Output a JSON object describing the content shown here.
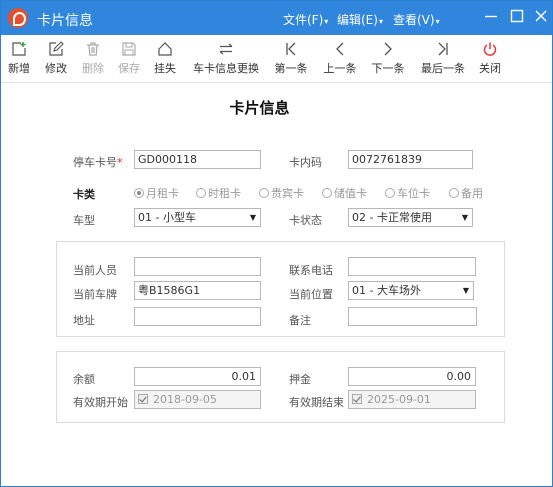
{
  "window": {
    "title": "卡片信息",
    "menus": [
      {
        "label": "文件(F)"
      },
      {
        "label": "编辑(E)"
      },
      {
        "label": "查看(V)"
      }
    ]
  },
  "toolbar": {
    "buttons": [
      {
        "label": "新增",
        "icon": "add-icon",
        "enabled": true
      },
      {
        "label": "修改",
        "icon": "edit-icon",
        "enabled": true
      },
      {
        "label": "删除",
        "icon": "trash-icon",
        "enabled": false
      },
      {
        "label": "保存",
        "icon": "save-icon",
        "enabled": false
      },
      {
        "label": "挂失",
        "icon": "home-icon",
        "enabled": true
      },
      {
        "label": "车卡信息更换",
        "icon": "swap-icon",
        "enabled": true
      },
      {
        "label": "第一条",
        "icon": "first-icon",
        "enabled": true
      },
      {
        "label": "上一条",
        "icon": "prev-icon",
        "enabled": true
      },
      {
        "label": "下一条",
        "icon": "next-icon",
        "enabled": true
      },
      {
        "label": "最后一条",
        "icon": "last-icon",
        "enabled": true
      },
      {
        "label": "关闭",
        "icon": "power-icon",
        "enabled": true
      }
    ]
  },
  "form": {
    "title": "卡片信息",
    "card_no": {
      "label": "停车卡号",
      "required": "*",
      "value": "GD000118"
    },
    "inner_code": {
      "label": "卡内码",
      "value": "0072761839"
    },
    "card_type": {
      "label": "卡类",
      "options": [
        "月租卡",
        "时租卡",
        "贵宾卡",
        "储值卡",
        "车位卡",
        "备用"
      ],
      "selected": "月租卡"
    },
    "vehicle_type": {
      "label": "车型",
      "value": "01 - 小型车"
    },
    "card_status": {
      "label": "卡状态",
      "value": "02 - 卡正常使用"
    }
  },
  "person": {
    "current_person": {
      "label": "当前人员",
      "value": ""
    },
    "phone": {
      "label": "联系电话",
      "value": ""
    },
    "plate": {
      "label": "当前车牌",
      "value": "粤B1586G1"
    },
    "location": {
      "label": "当前位置",
      "value": "01 - 大车场外"
    },
    "address": {
      "label": "地址",
      "value": ""
    },
    "remark": {
      "label": "备注",
      "value": ""
    }
  },
  "finance": {
    "balance": {
      "label": "余额",
      "value": "0.01"
    },
    "deposit": {
      "label": "押金",
      "value": "0.00"
    },
    "valid_start": {
      "label": "有效期开始",
      "value": "2018-09-05"
    },
    "valid_end": {
      "label": "有效期结束",
      "value": "2025-09-01"
    }
  },
  "colors": {
    "titlebar": "#2f86dc",
    "close_icon": "#e53935",
    "required": "#e02020"
  }
}
